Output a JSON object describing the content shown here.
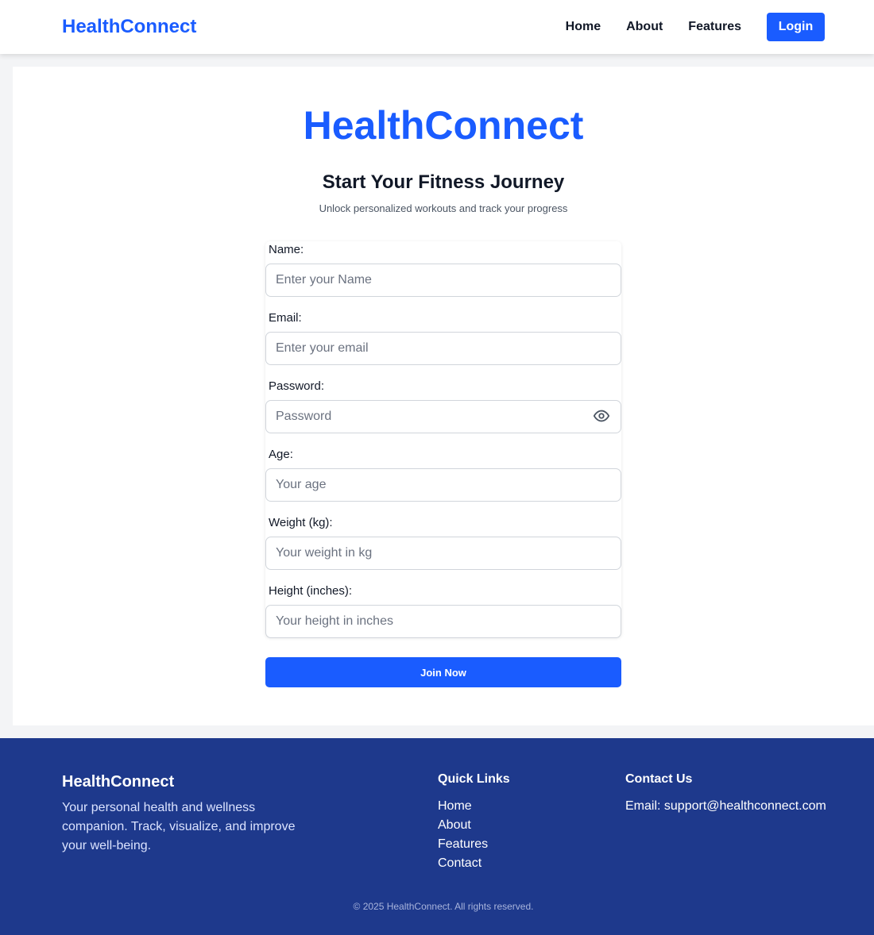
{
  "navbar": {
    "brand": "HealthConnect",
    "links": [
      "Home",
      "About",
      "Features"
    ],
    "login_label": "Login"
  },
  "hero": {
    "title": "HealthConnect",
    "subtitle": "Start Your Fitness Journey",
    "tagline": "Unlock personalized workouts and track your progress"
  },
  "form": {
    "fields": [
      {
        "label": "Name:",
        "placeholder": "Enter your Name"
      },
      {
        "label": "Email:",
        "placeholder": "Enter your email"
      },
      {
        "label": "Password:",
        "placeholder": "Password",
        "icon": "eye-icon"
      },
      {
        "label": "Age:",
        "placeholder": "Your age"
      },
      {
        "label": "Weight (kg):",
        "placeholder": "Your weight in kg"
      },
      {
        "label": "Height (inches):",
        "placeholder": "Your height in inches"
      }
    ],
    "submit_label": "Join Now"
  },
  "footer": {
    "brand": "HealthConnect",
    "description": "Your personal health and wellness companion. Track, visualize, and improve your well-being.",
    "quick_links_heading": "Quick Links",
    "quick_links": [
      "Home",
      "About",
      "Features",
      "Contact"
    ],
    "contact_heading": "Contact Us",
    "contact_email": "Email: support@healthconnect.com",
    "copyright": "© 2025 HealthConnect. All rights reserved."
  },
  "colors": {
    "accent": "#1a5cff",
    "footer_bg": "#1e398c",
    "page_bg": "#f3f4f6"
  }
}
